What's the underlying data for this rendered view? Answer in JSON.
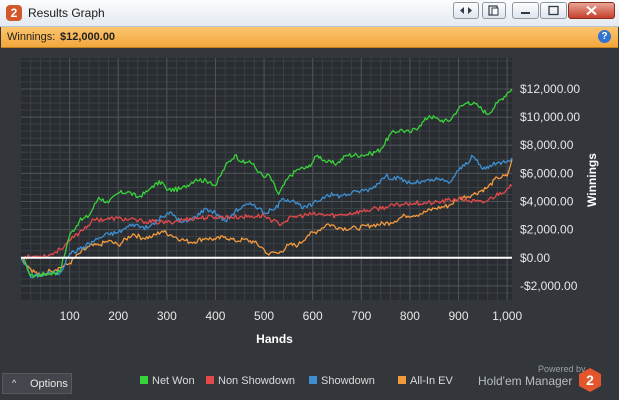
{
  "window": {
    "title": "Results Graph",
    "app_icon_text": "2",
    "buttons": [
      "nav-arrows",
      "copy",
      "minimize",
      "maximize",
      "close"
    ]
  },
  "infobar": {
    "label": "Winnings:",
    "value": "$12,000.00",
    "help_icon_text": "?"
  },
  "chart_data": {
    "type": "line",
    "xlabel": "Hands",
    "ylabel": "Winnings",
    "xlim": [
      0,
      1010
    ],
    "ylim": [
      -3000,
      14200
    ],
    "x_ticks": [
      100,
      200,
      300,
      400,
      500,
      600,
      700,
      800,
      900,
      1000
    ],
    "x_tick_labels": [
      "100",
      "200",
      "300",
      "400",
      "500",
      "600",
      "700",
      "800",
      "900",
      "1,000"
    ],
    "y_ticks": [
      -2000,
      0,
      2000,
      4000,
      6000,
      8000,
      10000,
      12000
    ],
    "y_tick_labels": [
      "-$2,000.00",
      "$0.00",
      "$2,000.00",
      "$4,000.00",
      "$6,000.00",
      "$8,000.00",
      "$10,000.00",
      "$12,000.00"
    ],
    "grid": true,
    "legend_position": "bottom",
    "background": "#292d31",
    "series": [
      {
        "name": "Net Won",
        "color": "#38d23a",
        "x": [
          0,
          10,
          20,
          40,
          60,
          80,
          100,
          120,
          140,
          160,
          180,
          200,
          220,
          240,
          260,
          270,
          290,
          300,
          330,
          360,
          390,
          400,
          420,
          440,
          460,
          470,
          490,
          500,
          510,
          530,
          550,
          570,
          590,
          610,
          630,
          650,
          670,
          700,
          720,
          740,
          760,
          780,
          800,
          820,
          840,
          860,
          880,
          900,
          920,
          940,
          960,
          980,
          1000,
          1010
        ],
        "y": [
          0,
          -400,
          -1300,
          -1200,
          -1100,
          -1000,
          1600,
          2600,
          3000,
          4300,
          3900,
          4600,
          4700,
          4300,
          4700,
          5100,
          5400,
          4800,
          4900,
          5600,
          5400,
          5100,
          6500,
          7300,
          6700,
          6900,
          6100,
          5700,
          5900,
          4500,
          5700,
          6300,
          6400,
          7300,
          6800,
          6700,
          7300,
          7300,
          7400,
          7700,
          8800,
          9100,
          8900,
          9400,
          10100,
          9800,
          9700,
          10600,
          11100,
          10800,
          10200,
          11000,
          11700,
          12000
        ]
      },
      {
        "name": "Non Showdown",
        "color": "#e2494b",
        "x": [
          0,
          30,
          60,
          80,
          100,
          120,
          150,
          200,
          250,
          300,
          350,
          400,
          450,
          500,
          530,
          560,
          600,
          650,
          700,
          750,
          800,
          850,
          900,
          950,
          1000,
          1010
        ],
        "y": [
          0,
          100,
          200,
          600,
          1200,
          1800,
          2700,
          2800,
          2600,
          2500,
          2800,
          2900,
          2900,
          3000,
          2400,
          2900,
          3100,
          3000,
          3300,
          3600,
          3900,
          3900,
          4200,
          3900,
          4900,
          5100
        ]
      },
      {
        "name": "Showdown",
        "color": "#3d8fd1",
        "x": [
          0,
          10,
          20,
          40,
          60,
          80,
          100,
          120,
          140,
          160,
          180,
          200,
          230,
          260,
          290,
          310,
          330,
          350,
          380,
          400,
          420,
          440,
          460,
          480,
          500,
          520,
          540,
          560,
          580,
          600,
          630,
          660,
          690,
          720,
          750,
          780,
          800,
          830,
          860,
          880,
          900,
          930,
          950,
          970,
          990,
          1010
        ],
        "y": [
          0,
          -500,
          -1400,
          -1200,
          -1100,
          -1100,
          300,
          600,
          1000,
          1400,
          1700,
          1800,
          2400,
          2100,
          2900,
          3200,
          2500,
          2700,
          3500,
          3200,
          2600,
          3300,
          3700,
          3800,
          3200,
          3400,
          4200,
          4100,
          3500,
          3800,
          4500,
          4400,
          4700,
          4900,
          5800,
          5600,
          5300,
          5400,
          5600,
          5300,
          6200,
          7200,
          6300,
          6600,
          6800,
          7100
        ]
      },
      {
        "name": "All-In EV",
        "color": "#f39a3e",
        "x": [
          0,
          20,
          40,
          60,
          80,
          100,
          120,
          140,
          160,
          180,
          200,
          230,
          250,
          270,
          290,
          310,
          330,
          350,
          380,
          400,
          420,
          440,
          460,
          480,
          500,
          510,
          520,
          530,
          550,
          570,
          590,
          610,
          630,
          660,
          690,
          720,
          760,
          790,
          820,
          850,
          880,
          900,
          930,
          960,
          980,
          1000,
          1010
        ],
        "y": [
          0,
          -800,
          -1300,
          -900,
          -700,
          -400,
          300,
          800,
          900,
          1200,
          900,
          1700,
          1400,
          1500,
          1900,
          1600,
          1300,
          1100,
          1400,
          1300,
          1500,
          1200,
          1300,
          1100,
          600,
          200,
          400,
          300,
          900,
          900,
          1600,
          1900,
          2400,
          2100,
          2100,
          2300,
          2500,
          3000,
          3100,
          3500,
          3700,
          4200,
          4500,
          5000,
          5700,
          5800,
          7000
        ]
      }
    ]
  },
  "options": {
    "label": "Options",
    "chevron": "^"
  },
  "brand": {
    "powered_by": "Powered by",
    "name": "Hold'em Manager",
    "logo_text": "2",
    "logo_color": "#e3562b"
  }
}
